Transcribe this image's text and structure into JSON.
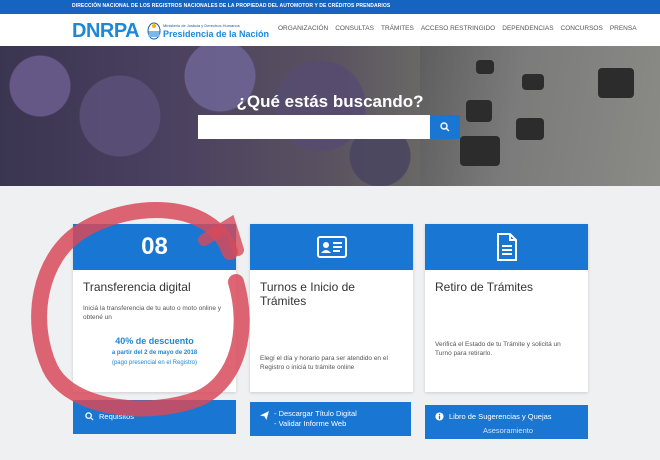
{
  "topbar": {
    "text": "DIRECCIÓN NACIONAL DE LOS REGISTROS NACIONALES DE LA PROPIEDAD DEL AUTOMOTOR Y DE CRÉDITOS PRENDARIOS"
  },
  "header": {
    "logo": "DNRPA",
    "ministry_line": "Ministerio de Justicia y Derechos Humanos",
    "presidency": "Presidencia de la Nación"
  },
  "nav": [
    "ORGANIZACIÓN",
    "CONSULTAS",
    "TRÁMITES",
    "ACCESO RESTRINGIDO",
    "DEPENDENCIAS",
    "CONCURSOS",
    "PRENSA"
  ],
  "hero": {
    "title": "¿Qué estás buscando?",
    "search_placeholder": ""
  },
  "cards": [
    {
      "number": "08",
      "title": "Transferencia digital",
      "desc": "Iniciá la transferencia de tu auto o moto online y obtené un",
      "promo_big": "40% de descuento",
      "promo_date": "a partir del 2 de mayo de 2018",
      "promo_note": "(pago presencial en el Registro)"
    },
    {
      "title_line1": "Turnos e Inicio de",
      "title_line2": "Trámites",
      "desc": "Elegí el día y horario para ser atendido en el Registro o iniciá tu trámite online"
    },
    {
      "title": "Retiro de Trámites",
      "desc": "Verificá el Estado de tu Trámite y solicitá un Turno para retirarlo."
    }
  ],
  "buttons": {
    "requisitos": "Requisitos",
    "descargar": "- Descargar Título Digital",
    "validar": "- Validar Informe Web",
    "libro": "Libro de Sugerencias y Quejas",
    "asesoramiento": "Asesoramiento"
  },
  "colors": {
    "primary": "#1976d2",
    "accent": "#1e88d6",
    "annotation": "#d84a5a"
  }
}
